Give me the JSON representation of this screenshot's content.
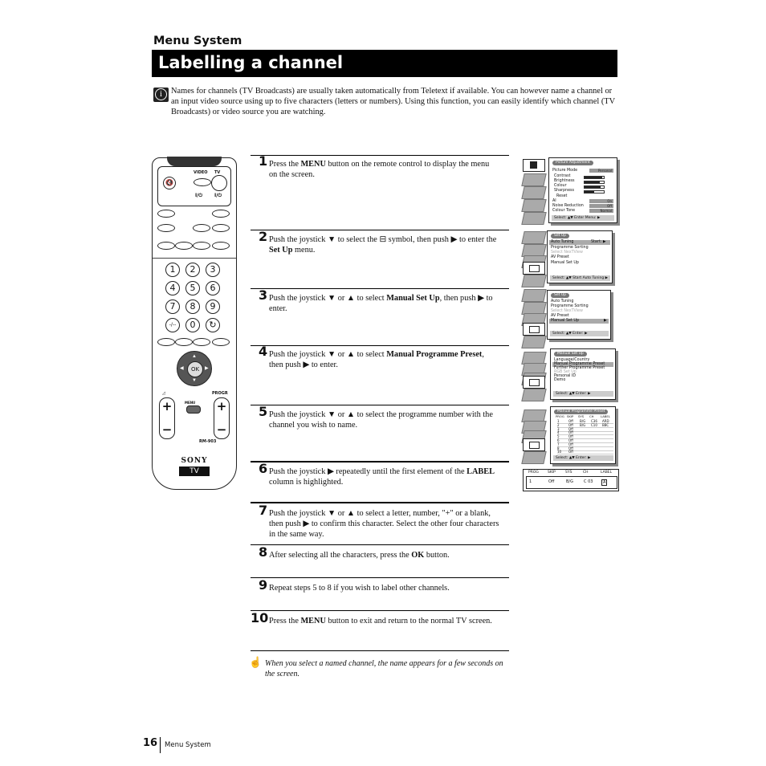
{
  "page": {
    "section": "Menu System",
    "title": "Labelling a channel",
    "intro_icon": "info-icon",
    "intro": "Names for channels (TV Broadcasts) are usually taken automatically from Teletext if available. You can however name a channel  or an input video source using up to five characters (letters or numbers). Using this function, you can easily identify which channel (TV Broadcasts) or video source you are watching.",
    "footer": {
      "page_number": "16",
      "section": "Menu System"
    }
  },
  "steps": [
    {
      "num": "1",
      "parts": [
        "Press the ",
        "MENU",
        " button on the remote control to display the menu on the screen."
      ]
    },
    {
      "num": "2",
      "parts": [
        "Push the joystick ▼ to select the ",
        "⊟",
        " symbol, then push ▶ to enter the ",
        "Set Up",
        " menu."
      ]
    },
    {
      "num": "3",
      "parts": [
        "Push the joystick ▼ or ▲ to select ",
        "Manual Set Up",
        ", then push ▶ to enter."
      ]
    },
    {
      "num": "4",
      "parts": [
        "Push the joystick ▼ or ▲ to select ",
        "Manual Programme Preset",
        ", then push ▶ to enter."
      ]
    },
    {
      "num": "5",
      "parts": [
        "Push the joystick ▼ or ▲ to select the programme number with the channel you wish to name.",
        "",
        ""
      ]
    },
    {
      "num": "6",
      "parts": [
        "Push the joystick ▶ repeatedly until the first element of the ",
        "LABEL",
        " column is highlighted."
      ]
    },
    {
      "num": "7",
      "parts": [
        "Push the joystick ▼ or ▲ to select a letter, number, \"+\" or a blank, then push ▶ to confirm this character. Select the other four characters in the same way.",
        "",
        ""
      ]
    },
    {
      "num": "8",
      "parts": [
        "After selecting all the characters, press the ",
        "OK",
        " button."
      ]
    },
    {
      "num": "9",
      "parts": [
        "Repeat steps 5 to 8 if you wish to label other channels.",
        "",
        ""
      ]
    },
    {
      "num": "10",
      "parts": [
        "Press the ",
        "MENU",
        " button to exit and return to the normal TV screen."
      ]
    }
  ],
  "note": {
    "icon": "hand-pointing-icon",
    "text": "When you select a named channel, the name appears for a few seconds on the screen."
  },
  "remote": {
    "video_label": "VIDEO",
    "tv_label": "TV",
    "power_symbol": "I/⏻",
    "digits": [
      "1",
      "2",
      "3",
      "4",
      "5",
      "6",
      "7",
      "8",
      "9",
      "-/--",
      "0",
      "↻"
    ],
    "ok_label": "OK",
    "menu_label": "MENU",
    "progr_label": "PROGR",
    "plus": "+",
    "minus": "−",
    "model": "RM-903",
    "brand": "SONY",
    "tv_badge": "TV"
  },
  "screens": {
    "picture_adjustment": {
      "title": "Picture Adjustment",
      "picture_mode_label": "Picture Mode",
      "picture_mode_value": "Personal",
      "sliders": [
        {
          "label": "Contrast",
          "level": 0.9
        },
        {
          "label": "Brightness",
          "level": 0.8
        },
        {
          "label": "Colour",
          "level": 0.85
        },
        {
          "label": "Sharpness",
          "level": 0.5
        }
      ],
      "reset": "Reset",
      "options": [
        {
          "label": "AI",
          "value": "On"
        },
        {
          "label": "Noise Reduction",
          "value": "Off"
        },
        {
          "label": "Colour Tone",
          "value": "Normal"
        }
      ],
      "footer": "Select: ▲▼  Enter Menu: ▶"
    },
    "set_up_1": {
      "title": "Set Up",
      "items": [
        "Auto Tuning",
        "Programme Sorting",
        "Select NexTView",
        "AV Preset",
        "Manual Set Up"
      ],
      "selected_value": "Start: ▶",
      "footer": "Select: ▲▼  Start Auto Tuning ▶"
    },
    "set_up_2": {
      "title": "Set Up",
      "items": [
        "Auto Tuning",
        "Programme Sorting",
        "Select NexTView",
        "AV Preset",
        "Manual Set Up"
      ],
      "footer": "Select: ▲▼  Enter: ▶"
    },
    "manual_set_up": {
      "title": "Manual Set Up",
      "items": [
        "Language/Country",
        "Manual Programme Preset",
        "Further Programme Preset",
        "RGB Set Up",
        "Personal ID",
        "Demo"
      ],
      "footer": "Select: ▲▼  Enter: ▶"
    },
    "manual_programme_preset": {
      "title": "Manual Programme Preset",
      "columns": [
        "PROG",
        "SKIP",
        "SYS",
        "CH",
        "LABEL"
      ],
      "rows": [
        [
          "1",
          "Off",
          "B/G",
          "C36",
          "ARD"
        ],
        [
          "2",
          "Off",
          "B/G",
          "C10",
          "BBC"
        ],
        [
          "3",
          "Off",
          "",
          "",
          ""
        ],
        [
          "4",
          "Off",
          "",
          "",
          ""
        ],
        [
          "5",
          "Off",
          "",
          "",
          ""
        ],
        [
          "6",
          "Off",
          "",
          "",
          ""
        ],
        [
          "7",
          "Off",
          "",
          "",
          ""
        ],
        [
          "8",
          "Off",
          "",
          "",
          ""
        ],
        [
          "10",
          "Off",
          "",
          "",
          ""
        ]
      ],
      "footer": "Select: ▲▼  Enter: ▶"
    },
    "label_edit": {
      "columns": [
        "PROG",
        "SKIP",
        "SYS",
        "CH",
        "LABEL"
      ],
      "values": [
        "1",
        "Off",
        "B/G",
        "C 03",
        "A"
      ]
    }
  }
}
